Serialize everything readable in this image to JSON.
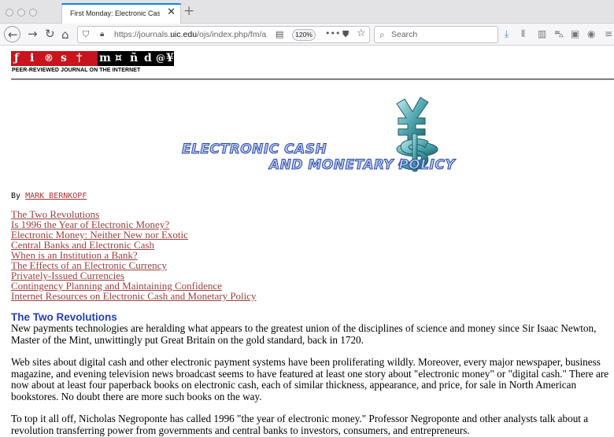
{
  "browser": {
    "tab_title": "First Monday: Electronic Cash and M",
    "url_prefix": "https://journals.",
    "url_domain": "uic.edu",
    "url_rest": "/ojs/index.php/fm/a",
    "zoom": "120%",
    "search_placeholder": "Search"
  },
  "logo": {
    "glyphs": [
      "ƒ",
      "i",
      "®",
      "s",
      "†",
      "m",
      "¤",
      "ñ",
      "d",
      "@",
      "¥"
    ],
    "tagline": "PEER-REVIEWED JOURNAL ON THE INTERNET"
  },
  "banner": {
    "line1": "ELECTRONIC CASH",
    "line2": "AND MONETARY POLICY"
  },
  "byline": {
    "prefix": "By",
    "author": "MARK BERNKOPF"
  },
  "toc": [
    "The Two Revolutions",
    "Is 1996 the Year of Electronic Money?",
    "Electronic Money: Neither New nor Exotic",
    "Central Banks and Electronic Cash",
    "When is an Institution a Bank?",
    "The Effects of an Electronic Currency",
    "Privately-Issued Currencies",
    "Contingency Planning and Maintaining Confidence",
    "Internet Resources on Electronic Cash and Monetary Policy"
  ],
  "article": {
    "heading": "The Two Revolutions",
    "paragraphs": [
      "New payments technologies are heralding what appears to the greatest union of the disciplines of science and money since Sir Isaac Newton, Master of the Mint, unwittingly put Great Britain on the gold standard, back in 1720.",
      "Web sites about digital cash and other electronic payment systems have been proliferating wildly. Moreover, every major newspaper, business magazine, and evening television news broadcast seems to have featured at least one story about \"electronic money\" or \"digital cash.\" There are now about at least four paperback books on electronic cash, each of similar thickness, appearance, and price, for sale in North American bookstores. No doubt there are more such books on the way.",
      "To top it all off, Nicholas Negroponte has called 1996 \"the year of electronic money.\" Professor Negroponte and other analysts talk about a revolution transferring power from governments and central banks to investors, consumers, and entrepreneurs."
    ]
  },
  "colors": {
    "link": "#9a3f3f",
    "heading": "#2340b5",
    "logo_red": "#c8141c",
    "banner_text": "#b9c9ea",
    "banner_outline": "#2b47b0",
    "accent": "#0a84ff"
  },
  "icons": [
    "back-icon",
    "forward-icon",
    "reload-icon",
    "home-icon",
    "shield-icon",
    "lock-icon",
    "reader-icon",
    "more-icon",
    "pocket-icon",
    "bookmark-star-icon",
    "search-icon",
    "download-icon",
    "library-icon",
    "sidebar-icon",
    "synced-tabs-icon",
    "account-icon",
    "menu-icon",
    "dollar-yen-graphic"
  ]
}
